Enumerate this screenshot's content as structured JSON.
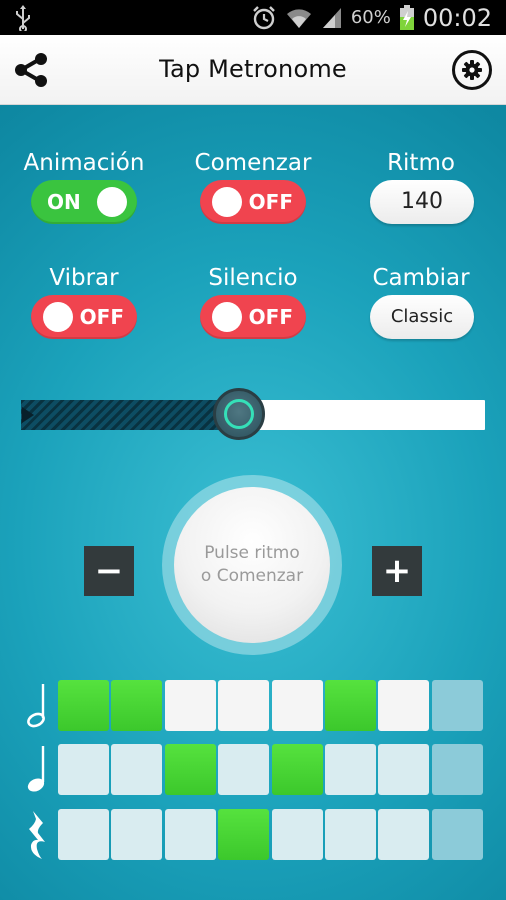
{
  "status_bar": {
    "battery": "60%",
    "time": "00:02",
    "icons": [
      "usb-icon",
      "alarm-icon",
      "wifi-icon",
      "signal-icon",
      "battery-charging-icon"
    ]
  },
  "app_bar": {
    "title": "Tap Metronome",
    "icons": [
      "share-icon",
      "gear-icon"
    ]
  },
  "controls": {
    "animation": {
      "label": "Animación",
      "state": "ON"
    },
    "start": {
      "label": "Comenzar",
      "state": "OFF"
    },
    "tempo": {
      "label": "Ritmo",
      "value": "140"
    },
    "vibrate": {
      "label": "Vibrar",
      "state": "OFF"
    },
    "silence": {
      "label": "Silencio",
      "state": "OFF"
    },
    "change": {
      "label": "Cambiar",
      "value": "Classic"
    }
  },
  "slider": {
    "value": 0.47
  },
  "tap": {
    "line1": "Pulse ritmo",
    "line2": "o Comenzar",
    "minus": "−",
    "plus": "+"
  },
  "colors": {
    "background": "#1ba2bb",
    "on_green": "#3ac43f",
    "off_red": "#f0444f",
    "beat_green": "#3cc82c"
  },
  "beat_grid": [
    {
      "note": "half-note-icon",
      "cells": [
        "green",
        "green",
        "white",
        "white",
        "white",
        "green",
        "white",
        "dim"
      ]
    },
    {
      "note": "quarter-note-icon",
      "cells": [
        "light",
        "light",
        "green",
        "light",
        "green",
        "light",
        "light",
        "dim"
      ]
    },
    {
      "note": "quarter-rest-icon",
      "cells": [
        "light",
        "light",
        "light",
        "green",
        "light",
        "light",
        "light",
        "dim"
      ]
    }
  ]
}
